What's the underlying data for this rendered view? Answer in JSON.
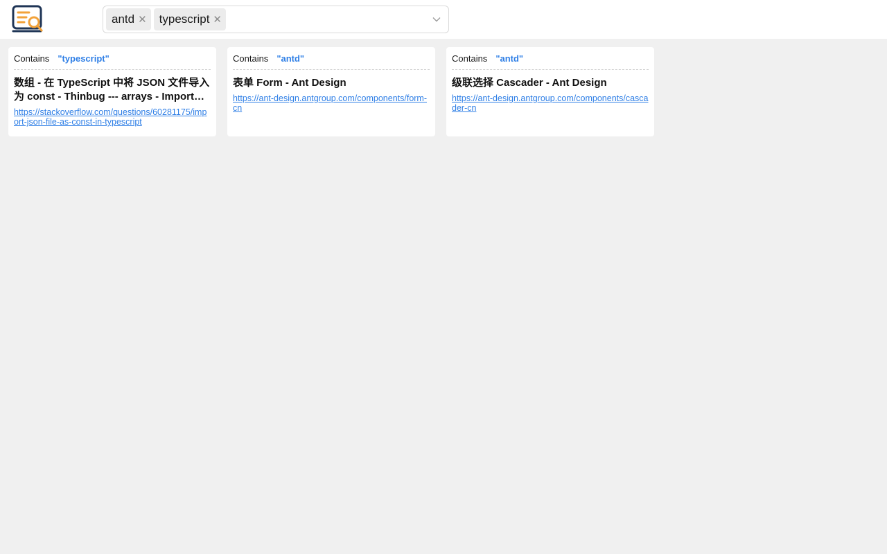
{
  "search": {
    "tags": [
      {
        "label": "antd"
      },
      {
        "label": "typescript"
      }
    ]
  },
  "results": [
    {
      "contains_label": "Contains",
      "keyword": "\"typescript\"",
      "title": "数组 - 在 TypeScript 中将 JSON 文件导入为 const - Thinbug --- arrays - Import JSON file as const in TypeScript",
      "url": "https://stackoverflow.com/questions/60281175/import-json-file-as-const-in-typescript"
    },
    {
      "contains_label": "Contains",
      "keyword": "\"antd\"",
      "title": "表单 Form - Ant Design",
      "url": "https://ant-design.antgroup.com/components/form-cn"
    },
    {
      "contains_label": "Contains",
      "keyword": "\"antd\"",
      "title": "级联选择 Cascader - Ant Design",
      "url": "https://ant-design.antgroup.com/components/cascader-cn"
    }
  ],
  "colors": {
    "accent": "#2f7fe6",
    "logo_dark": "#1f3556",
    "logo_orange": "#f2a23a"
  }
}
